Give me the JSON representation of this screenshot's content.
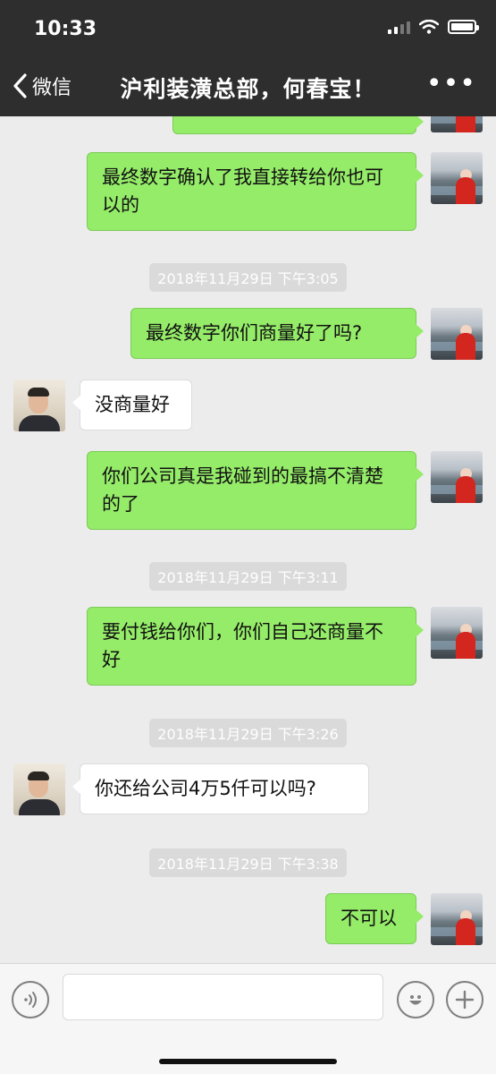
{
  "status_bar": {
    "time": "10:33"
  },
  "nav": {
    "back_label": "微信",
    "title": "沪利装潢总部，何春宝！",
    "more_label": "•••"
  },
  "messages": [
    {
      "side": "right",
      "text": "最终数字确认了我直接转给你也可以的"
    },
    {
      "timestamp": "2018年11月29日 下午3:05"
    },
    {
      "side": "right",
      "text": "最终数字你们商量好了吗?"
    },
    {
      "side": "left",
      "text": "没商量好"
    },
    {
      "side": "right",
      "text": "你们公司真是我碰到的最搞不清楚的了"
    },
    {
      "timestamp": "2018年11月29日 下午3:11"
    },
    {
      "side": "right",
      "text": "要付钱给你们，你们自己还商量不好"
    },
    {
      "timestamp": "2018年11月29日 下午3:26"
    },
    {
      "side": "left",
      "text": "你还给公司4万5仟可以吗?"
    },
    {
      "timestamp": "2018年11月29日 下午3:38"
    },
    {
      "side": "right",
      "text": "不可以"
    }
  ],
  "colors": {
    "header": "#2e2e2e",
    "chat_bg": "#ececec",
    "my_bubble": "#95ec69",
    "other_bubble": "#ffffff"
  },
  "icons": [
    "chevron-left-icon",
    "more-icon",
    "signal-icon",
    "wifi-icon",
    "battery-icon",
    "voice-icon",
    "emoji-icon",
    "plus-icon"
  ]
}
